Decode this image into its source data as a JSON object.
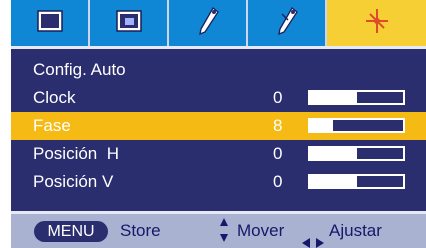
{
  "tabs": [
    {
      "icon": "picture-icon",
      "selected": false
    },
    {
      "icon": "screen-icon",
      "selected": false
    },
    {
      "icon": "tools-icon",
      "selected": false
    },
    {
      "icon": "tools-options-icon",
      "selected": false
    },
    {
      "icon": "screen-adjust-icon",
      "selected": true
    }
  ],
  "menu": {
    "items": [
      {
        "label": "Config. Auto",
        "value": "",
        "level": null
      },
      {
        "label": "Clock",
        "value": "0",
        "level": 0.5
      },
      {
        "label": "Fase",
        "value": "8",
        "level": 0.25
      },
      {
        "label": "Posición  H",
        "value": "0",
        "level": 0.5
      },
      {
        "label": "Posición V",
        "value": "0",
        "level": 0.5
      }
    ],
    "selected_index": 2
  },
  "footer": {
    "menu_key": "MENU",
    "store_label": "Store",
    "move_label": "Mover",
    "adjust_label": "Ajustar"
  },
  "colors": {
    "background": "#2a2d6e",
    "tab": "#0f87d4",
    "tab_selected": "#f6cf34",
    "row_selected": "#f6ba14",
    "footer": "#aab2d2"
  }
}
